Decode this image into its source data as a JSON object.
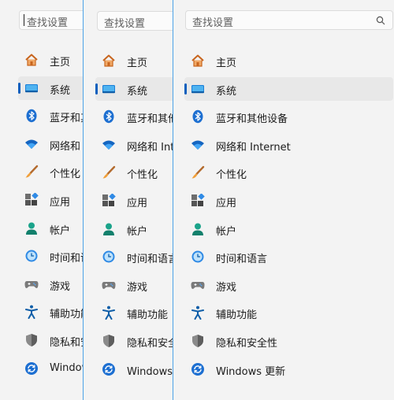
{
  "search": {
    "placeholder": "查找设置"
  },
  "panels": [
    {
      "visible_labels": [
        "主页",
        "系统",
        "蓝牙和其",
        "网络和 I",
        "个性化",
        "应用",
        "帐户",
        "时间和语",
        "游戏",
        "辅助功能",
        "隐私和安",
        "Window"
      ]
    },
    {
      "visible_labels": [
        "主页",
        "系统",
        "蓝牙和其他",
        "网络和 Inte",
        "个性化",
        "应用",
        "帐户",
        "时间和语言",
        "游戏",
        "辅助功能",
        "隐私和安全",
        "Windows 更"
      ]
    },
    {
      "visible_labels": [
        "主页",
        "系统",
        "蓝牙和其他设备",
        "网络和 Internet",
        "个性化",
        "应用",
        "帐户",
        "时间和语言",
        "游戏",
        "辅助功能",
        "隐私和安全性",
        "Windows 更新"
      ]
    }
  ],
  "nav_icons": [
    "home-icon",
    "system-icon",
    "bluetooth-icon",
    "wifi-icon",
    "personalize-icon",
    "apps-icon",
    "account-icon",
    "time-language-icon",
    "gaming-icon",
    "accessibility-icon",
    "privacy-icon",
    "windows-update-icon"
  ],
  "selected_index": 1,
  "colors": {
    "accent": "#0a5fbd",
    "divider": "#4da3e8",
    "background": "#f3f3f3"
  }
}
